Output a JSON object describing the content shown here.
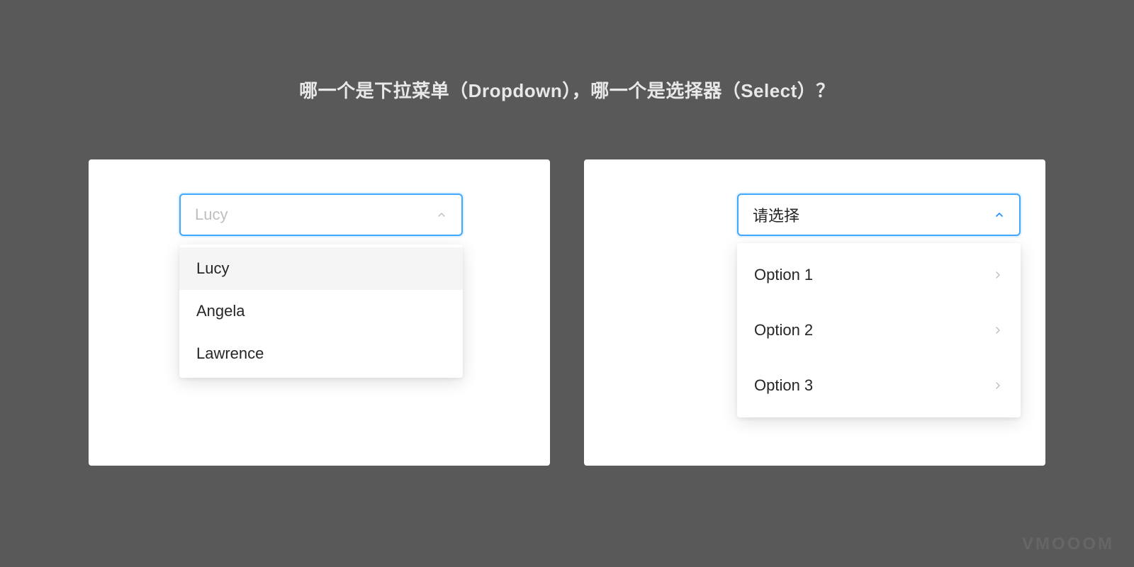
{
  "heading": "哪一个是下拉菜单（Dropdown），哪一个是选择器（Select）？",
  "left": {
    "value": "Lucy",
    "options": [
      "Lucy",
      "Angela",
      "Lawrence"
    ]
  },
  "right": {
    "value": "请选择",
    "options": [
      "Option 1",
      "Option 2",
      "Option 3"
    ]
  },
  "watermark": "VMOOOM"
}
